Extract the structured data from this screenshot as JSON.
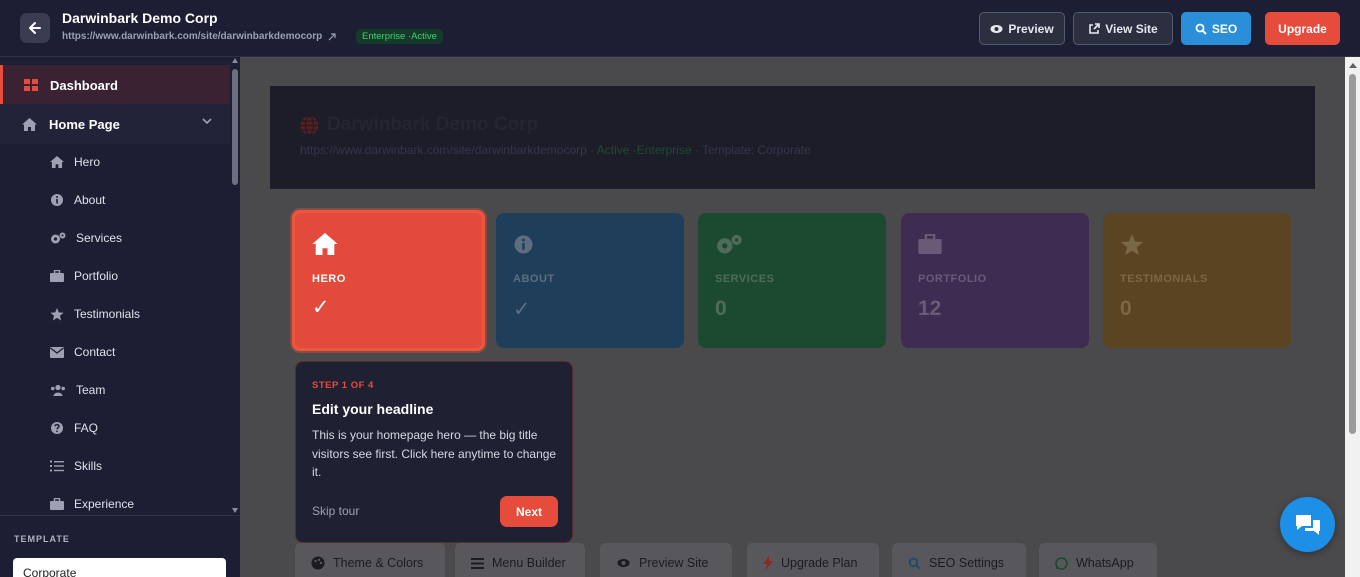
{
  "header": {
    "title": "Darwinbark Demo Corp",
    "url": "https://www.darwinbark.com/site/darwinbarkdemocorp",
    "plan_badge": "Enterprise ·Active",
    "buttons": {
      "preview": "Preview",
      "view_site": "View Site",
      "seo": "SEO",
      "upgrade": "Upgrade"
    }
  },
  "sidebar": {
    "dashboard": "Dashboard",
    "home_page": "Home Page",
    "items": [
      {
        "label": "Hero",
        "icon": "home-icon"
      },
      {
        "label": "About",
        "icon": "info-icon"
      },
      {
        "label": "Services",
        "icon": "gears-icon"
      },
      {
        "label": "Portfolio",
        "icon": "briefcase-icon"
      },
      {
        "label": "Testimonials",
        "icon": "star-icon"
      },
      {
        "label": "Contact",
        "icon": "envelope-icon"
      },
      {
        "label": "Team",
        "icon": "users-icon"
      },
      {
        "label": "FAQ",
        "icon": "question-icon"
      },
      {
        "label": "Skills",
        "icon": "list-icon"
      },
      {
        "label": "Experience",
        "icon": "briefcase-icon"
      }
    ],
    "template_label": "TEMPLATE",
    "template_value": "Corporate"
  },
  "banner": {
    "title": "Darwinbark Demo Corp",
    "url": "https://www.darwinbark.com/site/darwinbarkdemocorp",
    "status": "· Active ·Enterprise",
    "template": "· Template: Corporate"
  },
  "cards": {
    "hero": {
      "label": "HERO",
      "value": "✓"
    },
    "about": {
      "label": "ABOUT",
      "value": "✓"
    },
    "services": {
      "label": "SERVICES",
      "value": "0"
    },
    "portfolio": {
      "label": "PORTFOLIO",
      "value": "12"
    },
    "testimonials": {
      "label": "TESTIMONIALS",
      "value": "0"
    }
  },
  "tour": {
    "step": "STEP 1 OF 4",
    "title": "Edit your headline",
    "body": "This is your homepage hero — the big title visitors see first. Click here anytime to change it.",
    "skip": "Skip tour",
    "next": "Next"
  },
  "quick_actions": {
    "theme": "Theme & Colors",
    "menu": "Menu Builder",
    "preview": "Preview Site",
    "upgrade": "Upgrade Plan",
    "seo": "SEO Settings",
    "whatsapp": "WhatsApp"
  },
  "colors": {
    "accent": "#e64b3c",
    "seo_blue": "#2a8fd8",
    "sidebar_bg": "#1c1f33",
    "active_green": "#3ecf6e"
  }
}
